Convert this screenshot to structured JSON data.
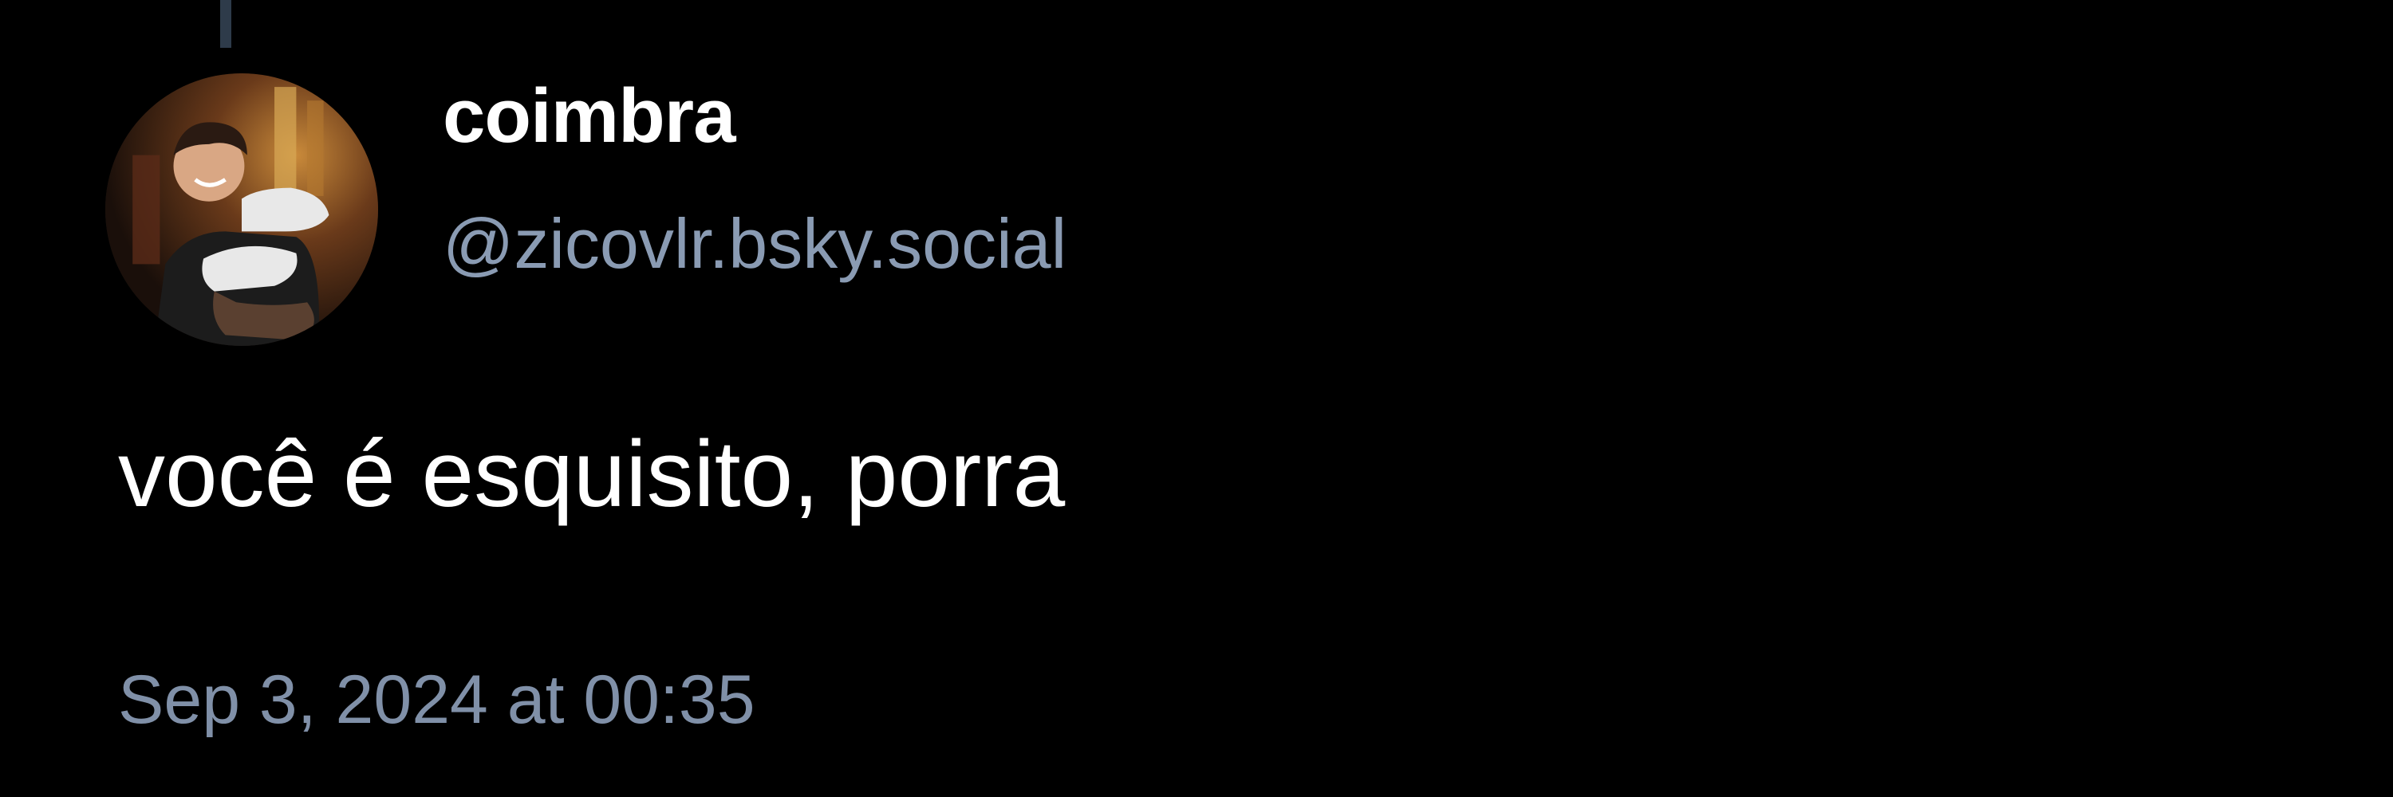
{
  "post": {
    "author": {
      "display_name": "coimbra",
      "handle": "@zicovlr.bsky.social",
      "avatar_icon": "user-avatar-photo"
    },
    "text": "você é esquisito, porra",
    "timestamp": "Sep 3, 2024 at 00:35"
  },
  "colors": {
    "background": "#000000",
    "primary_text": "#ffffff",
    "secondary_text": "#8a9bb3",
    "thread_line": "#2e3b4a"
  }
}
